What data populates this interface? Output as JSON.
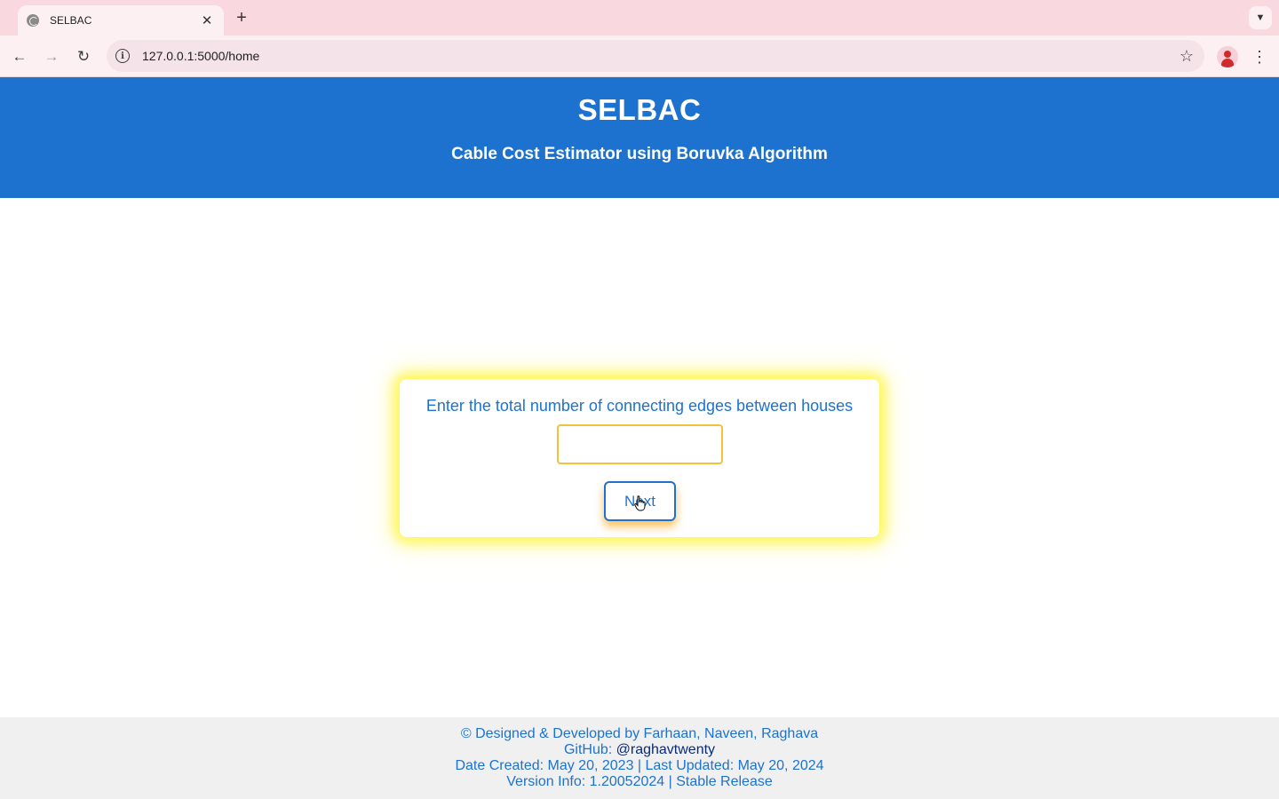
{
  "browser": {
    "tab_title": "SELBAC",
    "url": "127.0.0.1:5000/home",
    "icons": {
      "favicon": "globe-icon",
      "close": "close-icon",
      "new_tab": "plus-icon",
      "tab_search": "chevron-down-icon",
      "back": "arrow-left-icon",
      "forward": "arrow-right-icon",
      "reload": "reload-icon",
      "site_info": "info-icon",
      "bookmark": "star-icon",
      "profile": "profile-icon",
      "menu": "kebab-menu-icon"
    }
  },
  "header": {
    "title": "SELBAC",
    "subtitle": "Cable Cost Estimator using Boruvka Algorithm"
  },
  "form": {
    "prompt": "Enter the total number of connecting edges between houses",
    "edges_value": "",
    "next_label": "Next"
  },
  "footer": {
    "credits": "© Designed & Developed by Farhaan, Naveen, Raghava",
    "github_label": "GitHub:",
    "github_handle": "@raghavtwenty",
    "dates": "Date Created: May 20, 2023 | Last Updated: May 20, 2024",
    "version": "Version Info: 1.20052024 | Stable Release"
  },
  "colors": {
    "header_bg": "#1d72cf",
    "accent_text": "#1d72cf",
    "input_border": "#f2c23a",
    "card_glow": "#fff43c",
    "button_shadow": "#ffaa1e",
    "footer_bg": "#f0f0f0",
    "tabstrip_bg": "#fad8e0"
  }
}
